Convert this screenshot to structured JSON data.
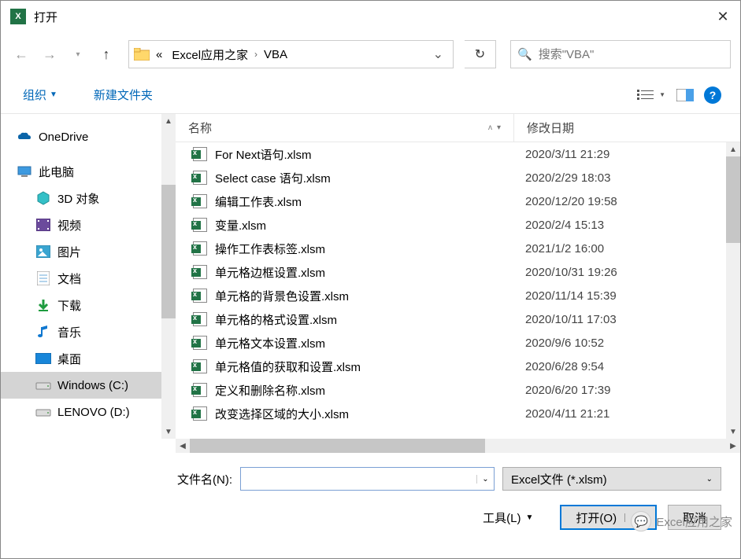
{
  "title": "打开",
  "breadcrumb": {
    "prefix": "«",
    "parts": [
      "Excel应用之家",
      "VBA"
    ]
  },
  "search": {
    "placeholder": "搜索\"VBA\""
  },
  "toolbar": {
    "organize": "组织",
    "newfolder": "新建文件夹"
  },
  "sidebar": [
    {
      "label": "OneDrive",
      "icon": "onedrive",
      "lvl": 0
    },
    {
      "label": "此电脑",
      "icon": "pc",
      "lvl": 0
    },
    {
      "label": "3D 对象",
      "icon": "3d",
      "lvl": 1
    },
    {
      "label": "视频",
      "icon": "video",
      "lvl": 1
    },
    {
      "label": "图片",
      "icon": "pictures",
      "lvl": 1
    },
    {
      "label": "文档",
      "icon": "docs",
      "lvl": 1
    },
    {
      "label": "下载",
      "icon": "download",
      "lvl": 1
    },
    {
      "label": "音乐",
      "icon": "music",
      "lvl": 1
    },
    {
      "label": "桌面",
      "icon": "desktop",
      "lvl": 1
    },
    {
      "label": "Windows (C:)",
      "icon": "drive",
      "lvl": 1,
      "selected": true
    },
    {
      "label": "LENOVO (D:)",
      "icon": "drive",
      "lvl": 1
    }
  ],
  "columns": {
    "name": "名称",
    "date": "修改日期"
  },
  "files": [
    {
      "name": "For Next语句.xlsm",
      "date": "2020/3/11 21:29"
    },
    {
      "name": "Select case 语句.xlsm",
      "date": "2020/2/29 18:03"
    },
    {
      "name": "编辑工作表.xlsm",
      "date": "2020/12/20 19:58"
    },
    {
      "name": "变量.xlsm",
      "date": "2020/2/4 15:13"
    },
    {
      "name": "操作工作表标签.xlsm",
      "date": "2021/1/2 16:00"
    },
    {
      "name": "单元格边框设置.xlsm",
      "date": "2020/10/31 19:26"
    },
    {
      "name": "单元格的背景色设置.xlsm",
      "date": "2020/11/14 15:39"
    },
    {
      "name": "单元格的格式设置.xlsm",
      "date": "2020/10/11 17:03"
    },
    {
      "name": "单元格文本设置.xlsm",
      "date": "2020/9/6 10:52"
    },
    {
      "name": "单元格值的获取和设置.xlsm",
      "date": "2020/6/28 9:54"
    },
    {
      "name": "定义和删除名称.xlsm",
      "date": "2020/6/20 17:39"
    },
    {
      "name": "改变选择区域的大小.xlsm",
      "date": "2020/4/11 21:21"
    }
  ],
  "bottom": {
    "fname_label": "文件名(N):",
    "filter": "Excel文件 (*.xlsm)",
    "tools": "工具(L)",
    "open": "打开(O)",
    "cancel": "取消"
  },
  "watermark": "Excel应用之家"
}
